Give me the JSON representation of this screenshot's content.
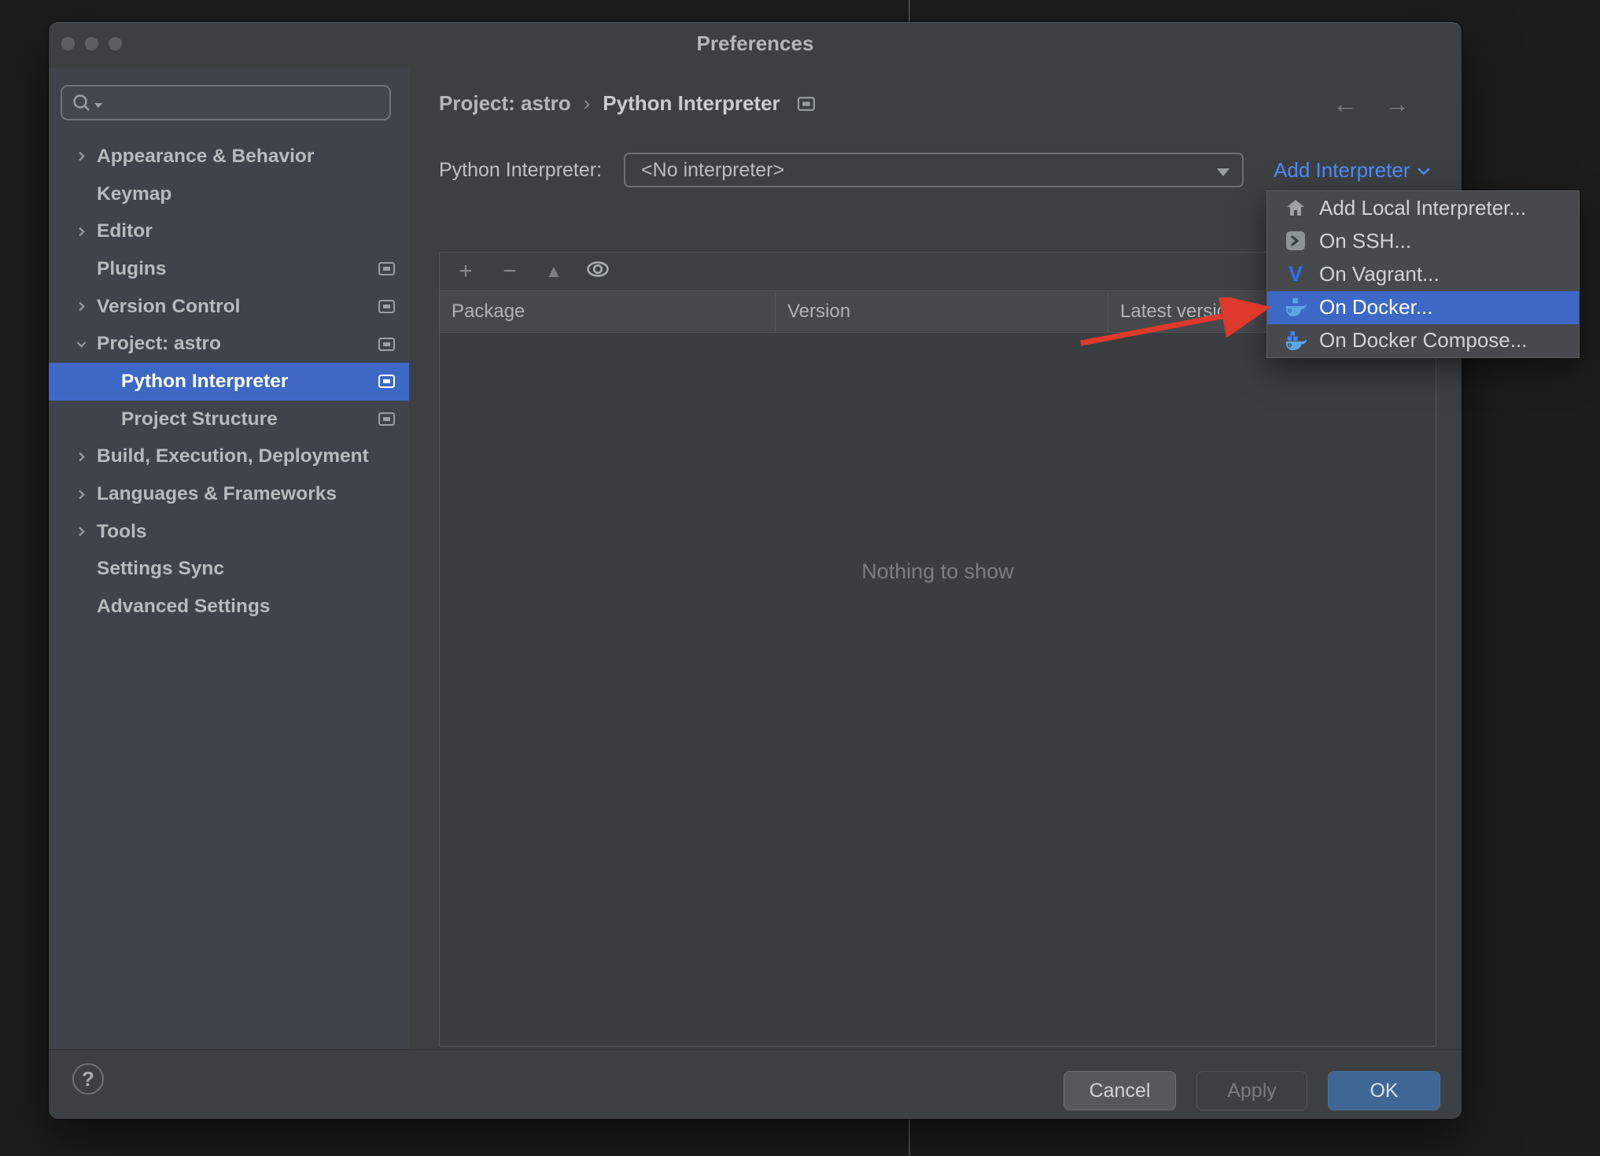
{
  "window": {
    "title": "Preferences"
  },
  "sidebar": {
    "search": {
      "placeholder": ""
    },
    "items": [
      {
        "label": "Appearance & Behavior"
      },
      {
        "label": "Keymap"
      },
      {
        "label": "Editor"
      },
      {
        "label": "Plugins"
      },
      {
        "label": "Version Control"
      },
      {
        "label": "Project: astro"
      },
      {
        "label": "Python Interpreter"
      },
      {
        "label": "Project Structure"
      },
      {
        "label": "Build, Execution, Deployment"
      },
      {
        "label": "Languages & Frameworks"
      },
      {
        "label": "Tools"
      },
      {
        "label": "Settings Sync"
      },
      {
        "label": "Advanced Settings"
      }
    ]
  },
  "breadcrumb": {
    "parent": "Project: astro",
    "separator": "›",
    "current": "Python Interpreter"
  },
  "interpreter": {
    "label": "Python Interpreter:",
    "value": "<No interpreter>",
    "add_link": "Add Interpreter"
  },
  "add_menu": {
    "items": [
      {
        "label": "Add Local Interpreter...",
        "icon": "home-icon"
      },
      {
        "label": "On SSH...",
        "icon": "ssh-icon"
      },
      {
        "label": "On Vagrant...",
        "icon": "vagrant-icon"
      },
      {
        "label": "On Docker...",
        "icon": "docker-icon",
        "selected": true
      },
      {
        "label": "On Docker Compose...",
        "icon": "docker-compose-icon"
      }
    ]
  },
  "package_panel": {
    "columns": [
      "Package",
      "Version",
      "Latest version"
    ],
    "empty_text": "Nothing to show",
    "toolbar_icons": [
      "add-icon",
      "remove-icon",
      "upgrade-icon",
      "show-early-releases-eye-icon"
    ]
  },
  "footer": {
    "help": "?",
    "cancel": "Cancel",
    "apply": "Apply",
    "ok": "OK"
  },
  "colors": {
    "selection_blue": "#3d68c5",
    "link_blue": "#4f8af7",
    "ok_button": "#3e6795",
    "annotation_arrow_red": "#df392b",
    "sidebar_bg": "#3e434c",
    "window_bg": "#3d4043"
  }
}
